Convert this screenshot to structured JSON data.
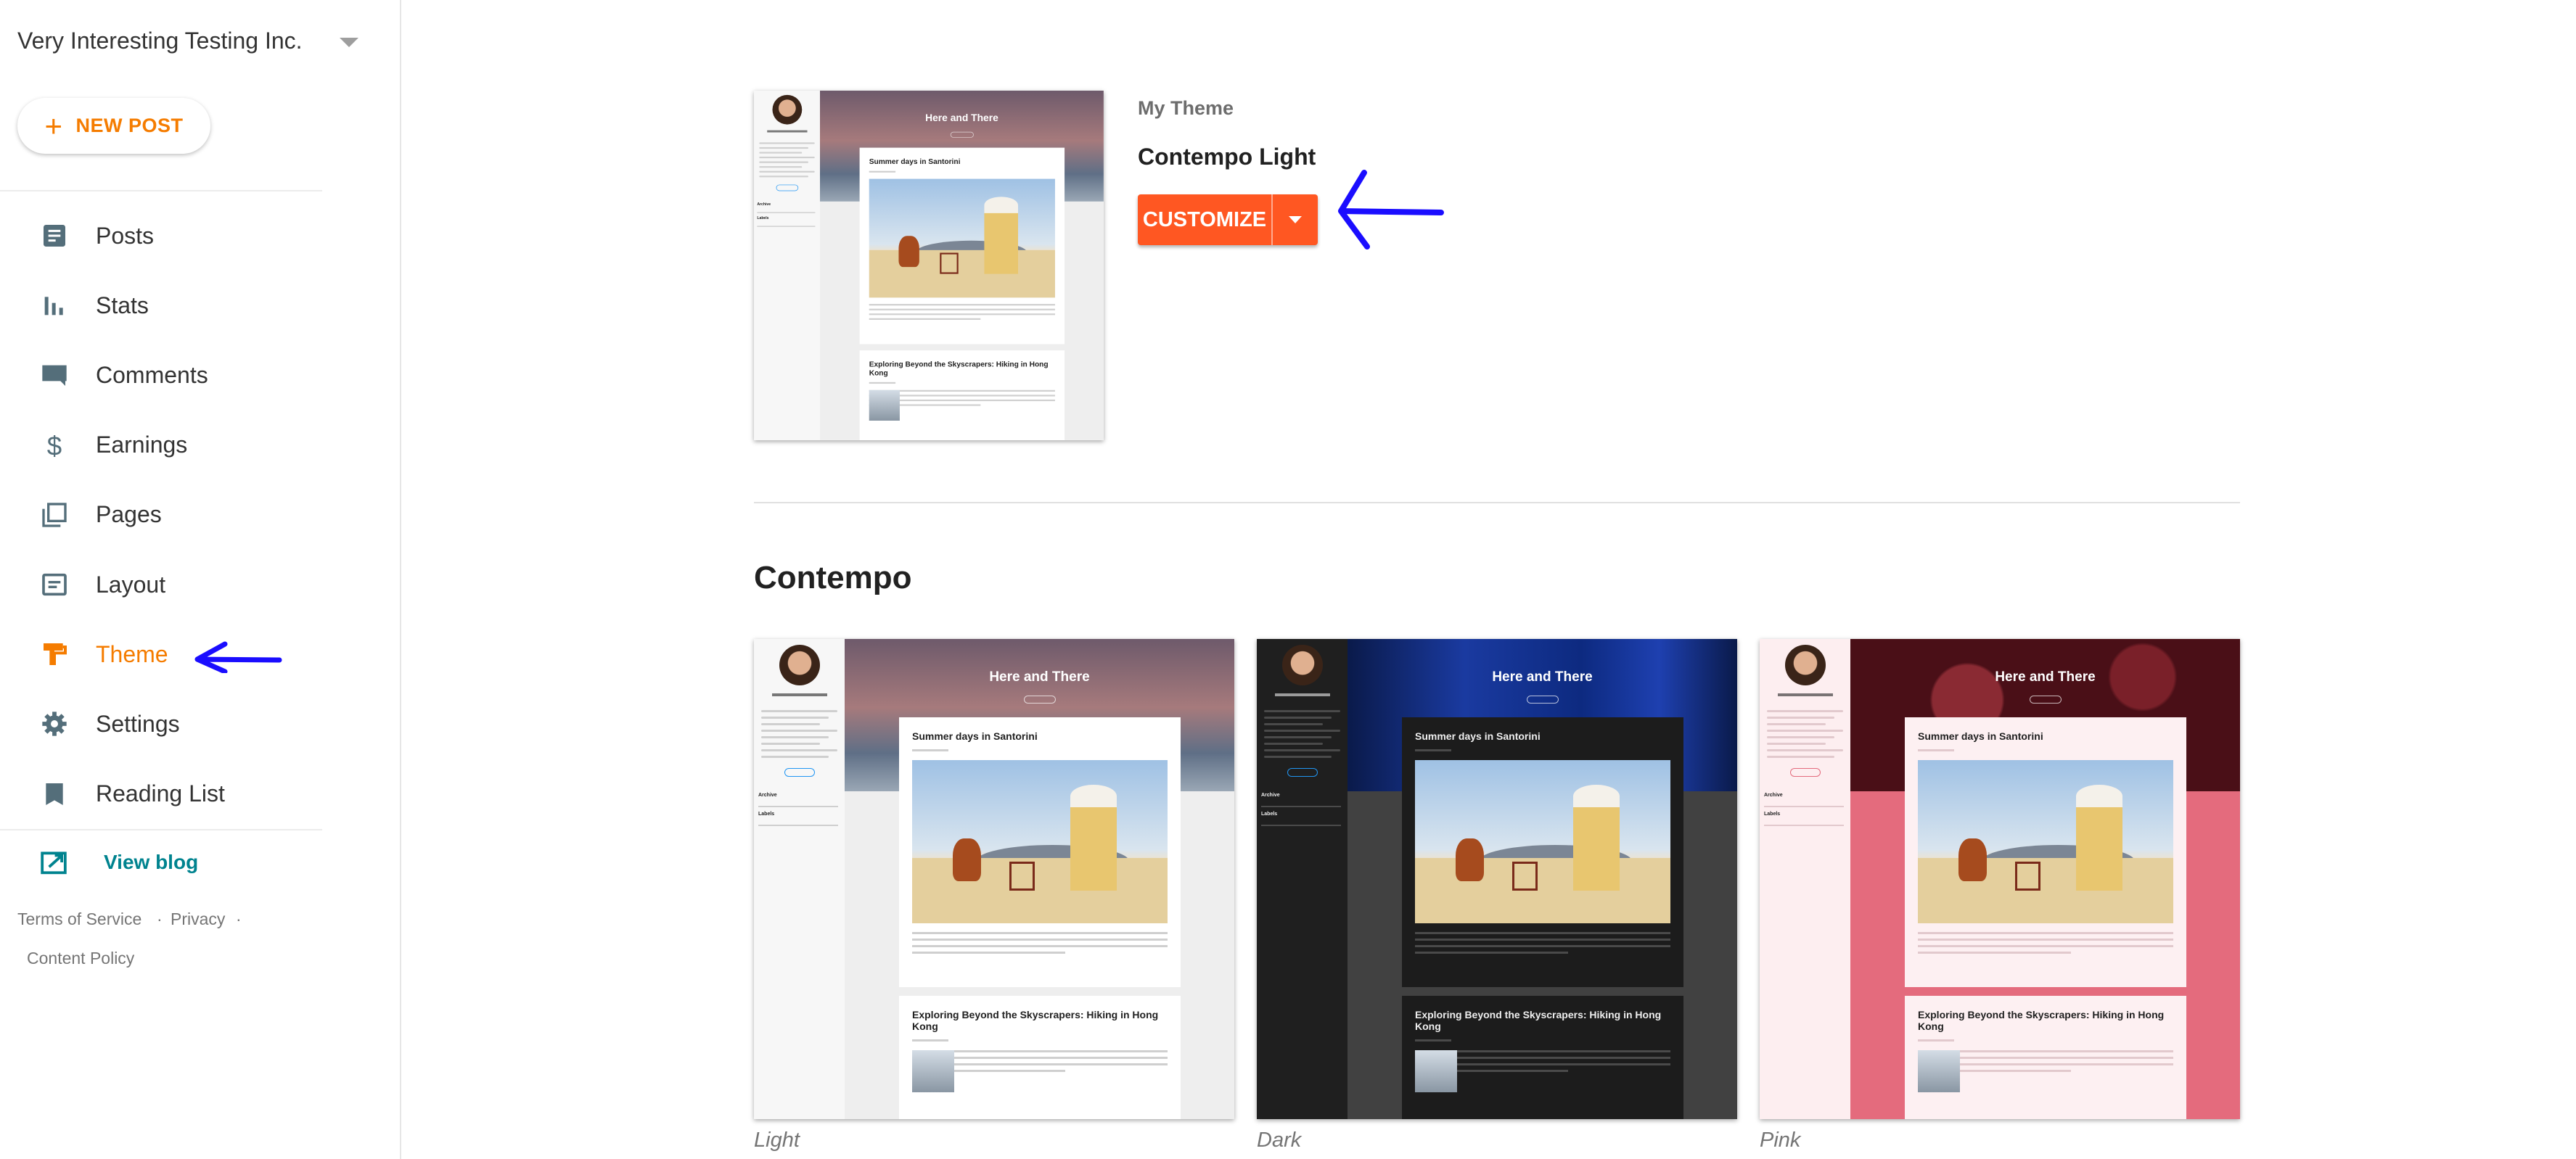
{
  "sidebar": {
    "org_name": "Very Interesting Testing Inc.",
    "new_post_label": "NEW POST",
    "items": [
      {
        "label": "Posts",
        "icon": "posts-icon"
      },
      {
        "label": "Stats",
        "icon": "stats-icon"
      },
      {
        "label": "Comments",
        "icon": "comments-icon"
      },
      {
        "label": "Earnings",
        "icon": "dollar-icon"
      },
      {
        "label": "Pages",
        "icon": "pages-icon"
      },
      {
        "label": "Layout",
        "icon": "layout-icon"
      },
      {
        "label": "Theme",
        "icon": "paint-roller-icon",
        "active": true
      },
      {
        "label": "Settings",
        "icon": "gear-icon"
      },
      {
        "label": "Reading List",
        "icon": "bookmark-icon"
      }
    ],
    "view_blog_label": "View blog",
    "footer": {
      "terms": "Terms of Service",
      "privacy": "Privacy",
      "content_policy": "Content Policy",
      "separator": "·"
    }
  },
  "my_theme": {
    "label": "My Theme",
    "name": "Contempo Light",
    "customize_label": "CUSTOMIZE"
  },
  "preview": {
    "blog_title": "Here and There",
    "post1_title": "Summer days in Santorini",
    "post2_title": "Exploring Beyond the Skyscrapers: Hiking in Hong Kong",
    "archive": "Archive",
    "labels": "Labels"
  },
  "gallery": {
    "title": "Contempo",
    "themes": [
      {
        "label": "Light",
        "colors": {
          "side": "#f7f7f7",
          "body": "#eeeeee",
          "card": "#ffffff",
          "text": "#212121",
          "line": "#cfcfcf",
          "hero": "linear-gradient(#6e5a6b,#a67a7c 45%,#5f6f86 75%,#9aa7b5)",
          "accent": "#2196f3"
        }
      },
      {
        "label": "Dark",
        "colors": {
          "side": "#1f1f1f",
          "body": "#414141",
          "card": "#1c1c1c",
          "text": "#eeeeee",
          "line": "#4a4a4a",
          "hero": "linear-gradient(90deg,#0a1a4a,#1a3aa0 30%,#0d2a80 60%,#1e40b0 80%,#0a1a4a)",
          "accent": "#2196f3"
        }
      },
      {
        "label": "Pink",
        "colors": {
          "side": "#fdeef0",
          "body": "#e46b7d",
          "card": "#fdf0f2",
          "text": "#212121",
          "line": "#e2c9cd",
          "hero": "radial-gradient(circle at 30% 40%,#8a2a33 0 12%,transparent 13%),radial-gradient(circle at 75% 25%,#7a2029 0 10%,transparent 11%),#4a0f17",
          "accent": "#e46b7d"
        }
      }
    ]
  },
  "accent_colors": {
    "orange": "#f57c00",
    "customize": "#ff5722",
    "link": "#00838f",
    "annotation_arrow": "#1a0dff"
  }
}
